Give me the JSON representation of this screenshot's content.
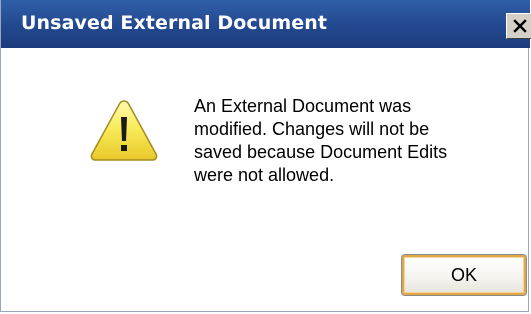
{
  "dialog": {
    "title": "Unsaved External Document",
    "close_label": "×",
    "icon": "warning-icon",
    "message_lines": [
      "An External Document was",
      "modified. Changes will not be",
      "saved because Document Edits",
      "were not allowed."
    ],
    "ok_label": "OK"
  },
  "colors": {
    "titlebar": "#23488f",
    "warning_fill": "#f7e34a",
    "ok_border": "#e0a84a"
  }
}
